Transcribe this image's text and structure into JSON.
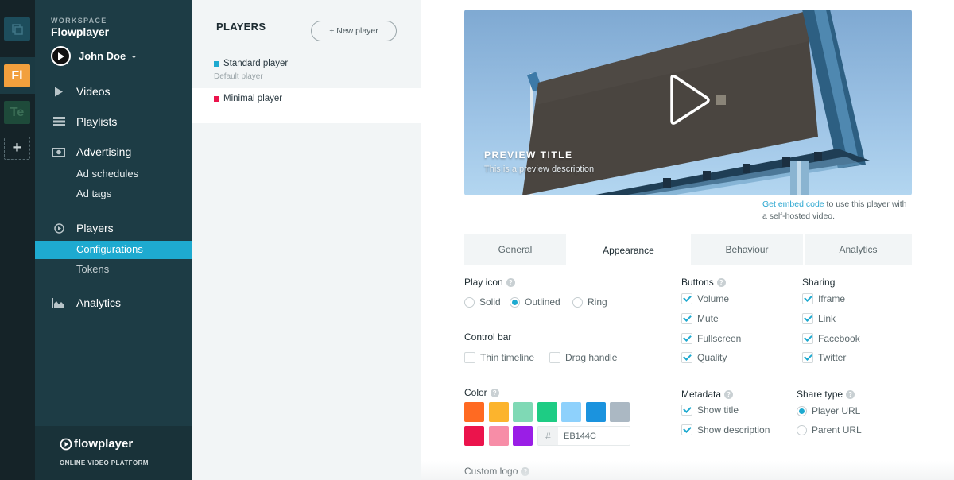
{
  "rail": {
    "workspaces": [
      {
        "label": "",
        "icon": "copy-icon"
      },
      {
        "label": "Fl",
        "color": "#F2A03D"
      },
      {
        "label": "Te",
        "color": "#1E4A3A"
      }
    ],
    "add_label": "+"
  },
  "nav": {
    "workspace_label": "WORKSPACE",
    "workspace_name": "Flowplayer",
    "user_name": "John Doe",
    "items": [
      {
        "label": "Videos",
        "icon": "play-icon"
      },
      {
        "label": "Playlists",
        "icon": "list-icon"
      },
      {
        "label": "Advertising",
        "icon": "money-icon",
        "children": [
          "Ad schedules",
          "Ad tags"
        ]
      },
      {
        "label": "Players",
        "icon": "play-circle-icon",
        "children": [
          "Configurations",
          "Tokens"
        ],
        "active_child": "Configurations"
      },
      {
        "label": "Analytics",
        "icon": "area-chart-icon"
      }
    ],
    "footer": {
      "brand": "flowplayer",
      "tagline": "ONLINE VIDEO PLATFORM"
    }
  },
  "players_panel": {
    "title": "PLAYERS",
    "new_button": "+ New player",
    "items": [
      {
        "name": "Standard player",
        "subtitle": "Default player",
        "color": "#1EAAD0"
      },
      {
        "name": "Minimal player",
        "subtitle": "",
        "color": "#EB144C"
      }
    ]
  },
  "preview": {
    "title": "PREVIEW TITLE",
    "description": "This is a preview description",
    "embed_link": "Get embed code",
    "embed_text": " to use this player with a self-hosted video."
  },
  "tabs": [
    {
      "label": "General",
      "active": false
    },
    {
      "label": "Appearance",
      "active": true
    },
    {
      "label": "Behaviour",
      "active": false
    },
    {
      "label": "Analytics",
      "active": false
    }
  ],
  "appearance": {
    "play_icon": {
      "label": "Play icon",
      "options": [
        "Solid",
        "Outlined",
        "Ring"
      ],
      "selected": "Outlined"
    },
    "control_bar": {
      "label": "Control bar",
      "options": [
        {
          "label": "Thin timeline",
          "checked": false
        },
        {
          "label": "Drag handle",
          "checked": false
        }
      ]
    },
    "color": {
      "label": "Color",
      "swatches": [
        "#FF6A22",
        "#FCB42D",
        "#7FD9B5",
        "#1ECC84",
        "#8ED1FC",
        "#1B93DE",
        "#ABB8C3",
        "#EB144C",
        "#F78DA7",
        "#9A1EE6"
      ],
      "hex_prefix": "#",
      "hex_value": "EB144C"
    },
    "buttons": {
      "label": "Buttons",
      "options": [
        {
          "label": "Volume",
          "checked": true
        },
        {
          "label": "Mute",
          "checked": true
        },
        {
          "label": "Fullscreen",
          "checked": true
        },
        {
          "label": "Quality",
          "checked": true
        }
      ]
    },
    "sharing": {
      "label": "Sharing",
      "options": [
        {
          "label": "Iframe",
          "checked": true
        },
        {
          "label": "Link",
          "checked": true
        },
        {
          "label": "Facebook",
          "checked": true
        },
        {
          "label": "Twitter",
          "checked": true
        }
      ]
    },
    "metadata": {
      "label": "Metadata",
      "options": [
        {
          "label": "Show title",
          "checked": true
        },
        {
          "label": "Show description",
          "checked": true
        }
      ]
    },
    "share_type": {
      "label": "Share type",
      "options": [
        "Player URL",
        "Parent URL"
      ],
      "selected": "Player URL"
    },
    "custom_logo": {
      "label": "Custom logo"
    }
  },
  "help_glyph": "?"
}
